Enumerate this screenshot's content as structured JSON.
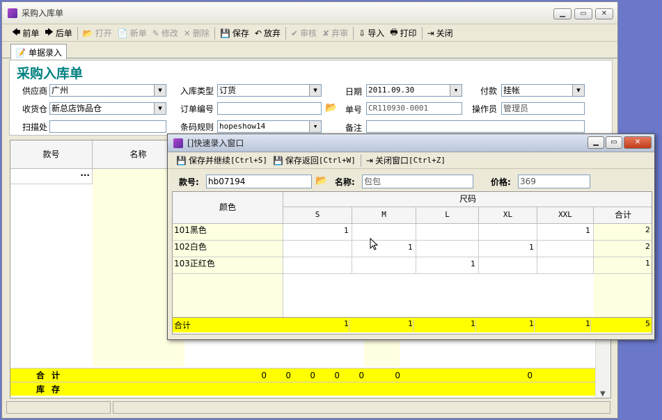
{
  "window": {
    "title": "采购入库单"
  },
  "toolbar": [
    {
      "label": "前单",
      "icon": "arrow-left-icon",
      "enabled": true
    },
    {
      "label": "后单",
      "icon": "arrow-right-icon",
      "enabled": true
    },
    {
      "label": "打开",
      "icon": "open-icon",
      "enabled": false
    },
    {
      "label": "新单",
      "icon": "new-doc-icon",
      "enabled": false
    },
    {
      "label": "修改",
      "icon": "edit-icon",
      "enabled": false
    },
    {
      "label": "删除",
      "icon": "delete-icon",
      "enabled": false
    },
    {
      "label": "保存",
      "icon": "save-icon",
      "enabled": true
    },
    {
      "label": "放弃",
      "icon": "undo-icon",
      "enabled": true
    },
    {
      "label": "审核",
      "icon": "audit-icon",
      "enabled": false
    },
    {
      "label": "弃审",
      "icon": "unaudit-icon",
      "enabled": false
    },
    {
      "label": "导入",
      "icon": "import-icon",
      "enabled": true
    },
    {
      "label": "打印",
      "icon": "print-icon",
      "enabled": true
    },
    {
      "label": "关闭",
      "icon": "exit-icon",
      "enabled": true
    }
  ],
  "tab": {
    "label": "单据录入"
  },
  "form": {
    "title": "采购入库单",
    "supplier_label": "供应商",
    "supplier": "广州",
    "inbound_type_label": "入库类型",
    "inbound_type": "订货",
    "date_label": "日期",
    "date": "2011.09.30",
    "payment_label": "付款",
    "payment": "挂帐",
    "warehouse_label": "收货仓",
    "warehouse": "新总店饰品仓",
    "order_no_label": "订单编号",
    "order_no": "",
    "doc_no_label": "单号",
    "doc_no": "CR110930-0001",
    "operator_label": "操作员",
    "operator": "管理员",
    "scan_label": "扫描处",
    "scan": "",
    "barcode_rule_label": "条码规则",
    "barcode_rule": "hopeshow14",
    "remark_label": "备注",
    "remark": ""
  },
  "grid": {
    "headers": [
      "款号",
      "名称"
    ],
    "sum_label": "合计",
    "stock_label": "库存",
    "sum_values": [
      "0",
      "0",
      "0",
      "0",
      "0",
      "0",
      "0"
    ]
  },
  "dialog": {
    "title": "[]快速录入窗口",
    "buttons": [
      {
        "label": "保存并继续",
        "shortcut": "[Ctrl+S]",
        "icon": "save-icon"
      },
      {
        "label": "保存返回",
        "shortcut": "[Ctrl+W]",
        "icon": "save-return-icon"
      },
      {
        "label": "关闭窗口",
        "shortcut": "[Ctrl+Z]",
        "icon": "exit-icon"
      }
    ],
    "style_label": "款号:",
    "style_no": "hb07194",
    "name_label": "名称:",
    "name": "包包",
    "price_label": "价格:",
    "price": "369",
    "color_header": "颜色",
    "size_header": "尺码",
    "sizes": [
      "S",
      "M",
      "L",
      "XL",
      "XXL"
    ],
    "total_header": "合计",
    "rows": [
      {
        "color": "101黑色",
        "qty": [
          "1",
          "",
          "",
          "",
          "1"
        ],
        "total": "2"
      },
      {
        "color": "102白色",
        "qty": [
          "",
          "1",
          "",
          "1",
          ""
        ],
        "total": "2"
      },
      {
        "color": "103正红色",
        "qty": [
          "",
          "",
          "1",
          "",
          ""
        ],
        "total": "1"
      }
    ],
    "sum_label": "合计",
    "sum": [
      "1",
      "1",
      "1",
      "1",
      "1"
    ],
    "sum_total": "5"
  }
}
